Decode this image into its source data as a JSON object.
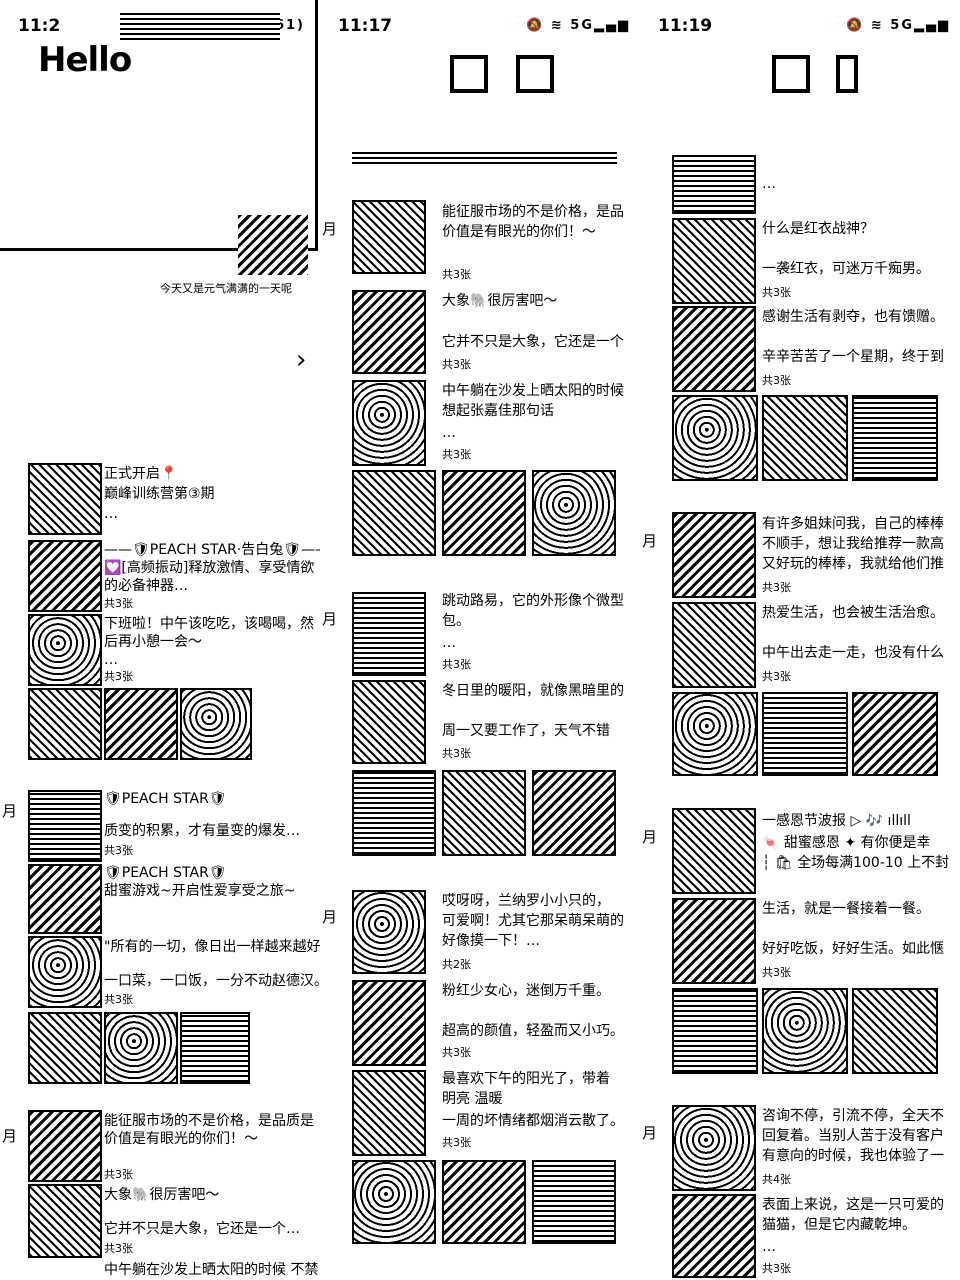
{
  "panel1": {
    "status_time": "11:2",
    "battery": "61",
    "hello": "Hello",
    "greeting": "今天又是元气满满的一天呢",
    "chevron": "›",
    "month_label": "月",
    "posts": [
      {
        "line1": "正式开启📍",
        "line2": "巅峰训练营第③期",
        "more": "…"
      },
      {
        "line1": "——🛡PEACH STAR·告白兔🛡——",
        "line2": "💟[高频振动]释放激情、享受情欲",
        "line3": "的必备神器…",
        "count": "共3张"
      },
      {
        "line1": "下班啦！中午该吃吃，该喝喝，然",
        "line2": "后再小憩一会～",
        "more": "…",
        "count": "共3张"
      },
      {
        "line1": "🛡PEACH STAR🛡",
        "line2": "质变的积累，才有量变的爆发…",
        "count": "共3张"
      },
      {
        "line1": "🛡PEACH STAR🛡",
        "line2": "甜蜜游戏~开启性爱享受之旅~",
        "count": ""
      },
      {
        "line1": "\"所有的一切，像日出一样越来越好\"",
        "count": ""
      },
      {
        "line1": "一口菜，一口饭，一分不动赵德汉。",
        "count": "共3张"
      },
      {
        "line1": "能征服市场的不是价格，是品质是",
        "line2": "价值是有眼光的你们！～",
        "count": "共3张"
      },
      {
        "line1": "大象🐘很厉害吧～",
        "count": ""
      },
      {
        "line1": "它并不只是大象，它还是一个…",
        "count": "共3张"
      },
      {
        "line1": "中午躺在沙发上晒太阳的时候 不禁",
        "count": ""
      }
    ]
  },
  "panel2": {
    "status_time": "11:17",
    "month_label": "月",
    "posts": [
      {
        "line1": "能征服市场的不是价格，是品",
        "line2": "价值是有眼光的你们！～",
        "count": "共3张"
      },
      {
        "line1": "大象🐘很厉害吧～",
        "count": ""
      },
      {
        "line1": "它并不只是大象，它还是一个",
        "count": "共3张"
      },
      {
        "line1": "中午躺在沙发上晒太阳的时候",
        "line2": "想起张嘉佳那句话",
        "more": "…",
        "count": "共3张"
      },
      {
        "line1": "跳动路易，它的外形像个微型",
        "line2": "包。",
        "more": "…",
        "count": "共3张"
      },
      {
        "line1": "冬日里的暖阳，就像黑暗里的",
        "count": ""
      },
      {
        "line1": "周一又要工作了，天气不错",
        "count": "共3张"
      },
      {
        "line1": "哎呀呀，兰纳罗小小只的，",
        "line2": "可爱啊！尤其它那呆萌呆萌的",
        "line3": "好像摸一下！…",
        "count": "共2张"
      },
      {
        "line1": "粉红少女心，迷倒万千重。",
        "count": ""
      },
      {
        "line1": "超高的颜值，轻盈而又小巧。",
        "count": "共3张"
      },
      {
        "line1": "最喜欢下午的阳光了，带着",
        "line2": "明亮 温暖",
        "count": ""
      },
      {
        "line1": "一周的坏情绪都烟消云散了。",
        "count": "共3张"
      }
    ]
  },
  "panel3": {
    "status_time": "11:19",
    "month_label": "月",
    "posts": [
      {
        "line1": "…",
        "count": ""
      },
      {
        "line1": "什么是红衣战神？",
        "count": ""
      },
      {
        "line1": "一袭红衣，可迷万千痴男。",
        "count": "共3张"
      },
      {
        "line1": "感谢生活有剥夺，也有馈赠。",
        "count": ""
      },
      {
        "line1": "辛辛苦苦了一个星期，终于到",
        "count": "共3张"
      },
      {
        "line1": "有许多姐妹问我，自己的棒棒",
        "line2": "不顺手，想让我给推荐一款高",
        "line3": "又好玩的棒棒，我就给他们推",
        "count": "共3张"
      },
      {
        "line1": "热爱生活，也会被生活治愈。",
        "count": ""
      },
      {
        "line1": "中午出去走一走，也没有什么",
        "count": "共3张"
      },
      {
        "line1": "一感恩节波报 ▷ 🎶 ıllıll",
        "line2": "🍬 甜蜜感恩 ✦ 有你便是幸",
        "line3": "┆ 🛍 全场每满100-10 上不封",
        "count": ""
      },
      {
        "line1": "生活，就是一餐接着一餐。",
        "count": ""
      },
      {
        "line1": "好好吃饭，好好生活。如此惬",
        "count": "共3张"
      },
      {
        "line1": "咨询不停，引流不停，全天不",
        "line2": "回复着。当别人苦于没有客户",
        "line3": "有意向的时候，我也体验了一",
        "count": "共4张"
      },
      {
        "line1": "表面上来说，这是一只可爱的",
        "line2": "猫猫，但是它内藏乾坤。",
        "more": "…",
        "count": "共3张"
      }
    ]
  }
}
